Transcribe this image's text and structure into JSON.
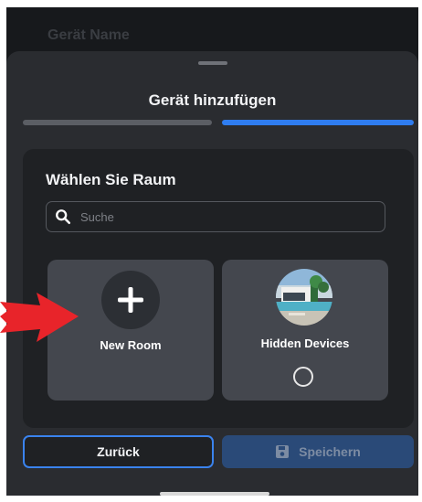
{
  "background": {
    "label": "Gerät Name"
  },
  "sheet": {
    "title": "Gerät hinzufügen",
    "progress": {
      "steps": 2,
      "current": 2,
      "colors": {
        "done": "#5b5e64",
        "active": "#2f7df0"
      }
    }
  },
  "panel": {
    "title": "Wählen Sie Raum",
    "search": {
      "placeholder": "Suche",
      "value": ""
    },
    "cards": [
      {
        "label": "New Room",
        "icon": "plus-icon"
      },
      {
        "label": "Hidden Devices",
        "icon": "room-photo",
        "selected": false
      }
    ]
  },
  "footer": {
    "back_label": "Zurück",
    "save_label": "Speichern",
    "save_icon": "save-icon"
  },
  "annotation": {
    "type": "red-arrow",
    "color": "#e8242a"
  }
}
